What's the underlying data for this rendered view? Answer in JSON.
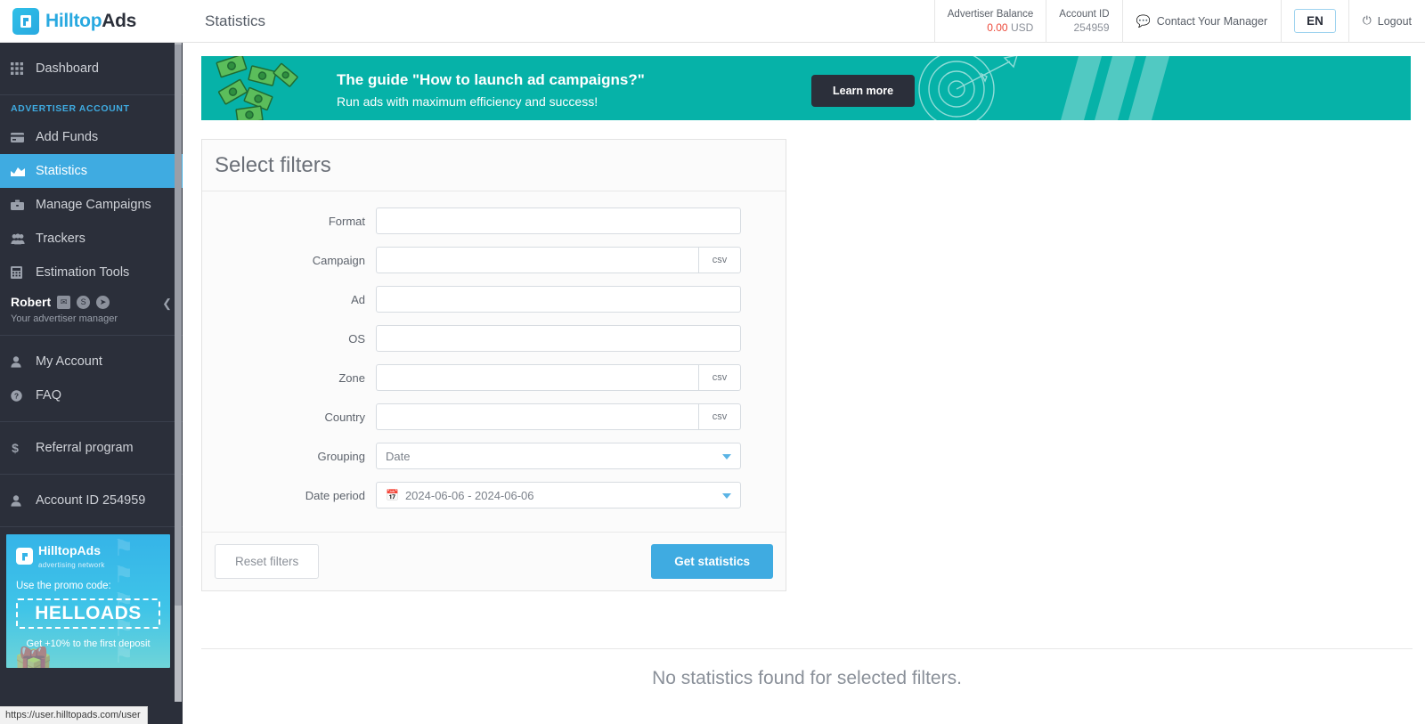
{
  "brand": {
    "logo_text_1": "Hilltop",
    "logo_text_2": "Ads",
    "accent_blue": "#3fabe1",
    "sidebar_bg": "#2b2f3a",
    "banner_teal": "#06b2a8",
    "balance_red": "#ec4a3b"
  },
  "header": {
    "page_title": "Statistics",
    "balance_label": "Advertiser Balance",
    "balance_value": "0.00",
    "balance_currency": "USD",
    "account_id_label": "Account ID",
    "account_id_value": "254959",
    "contact_manager": "Contact Your Manager",
    "language": "EN",
    "logout": "Logout"
  },
  "sidebar": {
    "dashboard": "Dashboard",
    "group_title": "ADVERTISER ACCOUNT",
    "items": [
      {
        "label": "Add Funds",
        "icon": "credit-card-icon"
      },
      {
        "label": "Statistics",
        "icon": "area-chart-icon"
      },
      {
        "label": "Manage Campaigns",
        "icon": "briefcase-icon"
      },
      {
        "label": "Trackers",
        "icon": "users-icon"
      },
      {
        "label": "Estimation Tools",
        "icon": "calculator-icon"
      }
    ],
    "manager": {
      "name": "Robert",
      "subtitle": "Your advertiser manager"
    },
    "account_items": [
      {
        "label": "My Account",
        "icon": "user-icon"
      },
      {
        "label": "FAQ",
        "icon": "question-circle-icon"
      }
    ],
    "referral": {
      "label": "Referral program",
      "icon": "dollar-icon"
    },
    "account_id": {
      "label": "Account ID 254959",
      "icon": "user-icon"
    },
    "promo": {
      "logo_title": "HilltopAds",
      "logo_sub": "advertising network",
      "use_text": "Use the promo code:",
      "code": "HELLOADS",
      "get_text": "Get +10% to the first deposit"
    }
  },
  "status_bar": {
    "url": "https://user.hilltopads.com/user"
  },
  "banner": {
    "headline": "The guide \"How to launch ad campaigns?\"",
    "subline": "Run ads with maximum efficiency and success!",
    "cta": "Learn more"
  },
  "filters": {
    "title": "Select filters",
    "fields": [
      {
        "label": "Format",
        "value": "",
        "csv": false
      },
      {
        "label": "Campaign",
        "value": "",
        "csv": true,
        "csv_label": "csv"
      },
      {
        "label": "Ad",
        "value": "",
        "csv": false
      },
      {
        "label": "OS",
        "value": "",
        "csv": false
      },
      {
        "label": "Zone",
        "value": "",
        "csv": true,
        "csv_label": "csv"
      },
      {
        "label": "Country",
        "value": "",
        "csv": true,
        "csv_label": "csv"
      }
    ],
    "grouping": {
      "label": "Grouping",
      "value": "Date"
    },
    "date_period": {
      "label": "Date period",
      "value": "2024-06-06 - 2024-06-06"
    },
    "reset_label": "Reset filters",
    "submit_label": "Get statistics"
  },
  "results": {
    "empty_message": "No statistics found for selected filters."
  }
}
